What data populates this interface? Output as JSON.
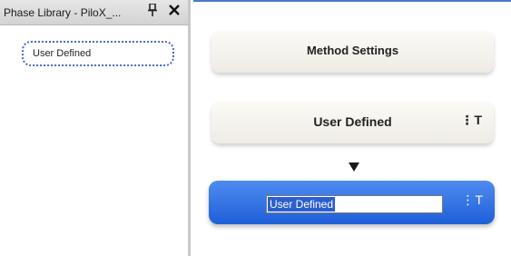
{
  "panel": {
    "title": "Phase Library - PiloX_...",
    "pin_glyph": "🞜",
    "close_glyph": "✕",
    "items": [
      {
        "label": "User Defined"
      }
    ]
  },
  "canvas": {
    "nodes": [
      {
        "label": "Method Settings"
      },
      {
        "label": "User Defined",
        "menu": "⋮T"
      }
    ],
    "selected_node": {
      "value": "User Defined",
      "menu": "⋮T"
    },
    "arrow": "down-arrow-icon"
  },
  "colors": {
    "accent_top_border": "#4a78c8",
    "selected_node_top": "#4f8bf0",
    "selected_node_bottom": "#1f5fd8",
    "dotted_selection": "#4a68c8"
  }
}
